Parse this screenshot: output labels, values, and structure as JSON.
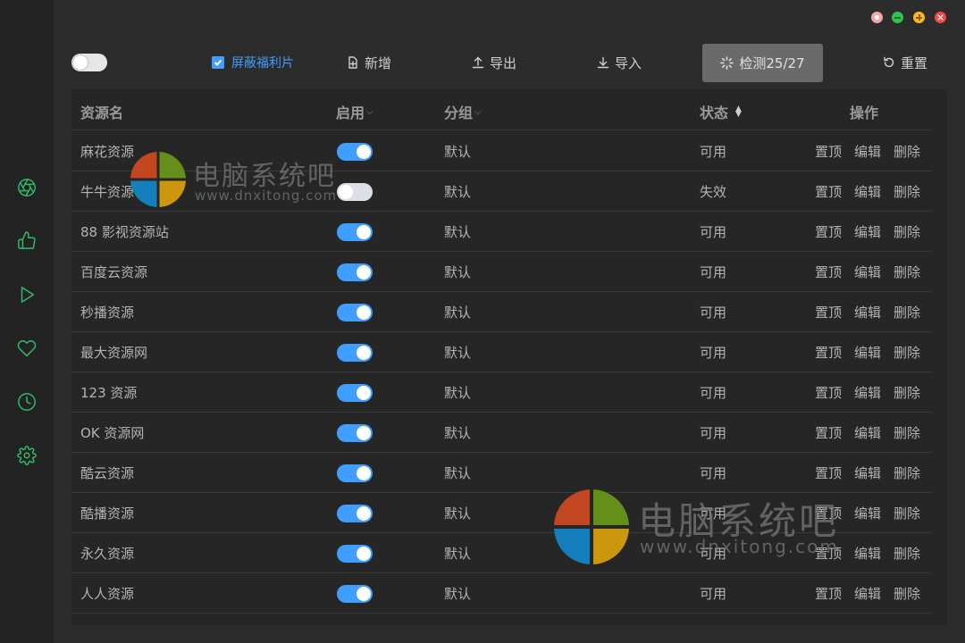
{
  "toolbar": {
    "block_checkbox_label": "屏蔽福利片",
    "add_label": "新增",
    "export_label": "导出",
    "import_label": "导入",
    "detect_label": "检测25/27",
    "reset_label": "重置"
  },
  "table": {
    "headers": {
      "name": "资源名",
      "enabled": "启用",
      "group": "分组",
      "status": "状态",
      "actions": "操作"
    },
    "rows": [
      {
        "name": "麻花资源",
        "enabled": true,
        "group": "默认",
        "status": "可用"
      },
      {
        "name": "牛牛资源",
        "enabled": false,
        "group": "默认",
        "status": "失效"
      },
      {
        "name": "88 影视资源站",
        "enabled": true,
        "group": "默认",
        "status": "可用"
      },
      {
        "name": "百度云资源",
        "enabled": true,
        "group": "默认",
        "status": "可用"
      },
      {
        "name": "秒播资源",
        "enabled": true,
        "group": "默认",
        "status": "可用"
      },
      {
        "name": "最大资源网",
        "enabled": true,
        "group": "默认",
        "status": "可用"
      },
      {
        "name": "123 资源",
        "enabled": true,
        "group": "默认",
        "status": "可用"
      },
      {
        "name": "OK 资源网",
        "enabled": true,
        "group": "默认",
        "status": "可用"
      },
      {
        "name": "酷云资源",
        "enabled": true,
        "group": "默认",
        "status": "可用"
      },
      {
        "name": "酷播资源",
        "enabled": true,
        "group": "默认",
        "status": "可用"
      },
      {
        "name": "永久资源",
        "enabled": true,
        "group": "默认",
        "status": "可用"
      },
      {
        "name": "人人资源",
        "enabled": true,
        "group": "默认",
        "status": "可用"
      }
    ],
    "action_labels": {
      "top": "置顶",
      "edit": "编辑",
      "delete": "删除"
    }
  },
  "watermark": {
    "title": "电脑系统吧",
    "url": "www.dnxitong.com"
  },
  "colors": {
    "accent": "#409eff",
    "sidebar_icon": "#2fbb6a",
    "background": "#2c2c2c"
  },
  "sidebar_icons": [
    "aperture-icon",
    "thumbs-up-icon",
    "play-icon",
    "heart-icon",
    "clock-icon",
    "settings-icon"
  ]
}
